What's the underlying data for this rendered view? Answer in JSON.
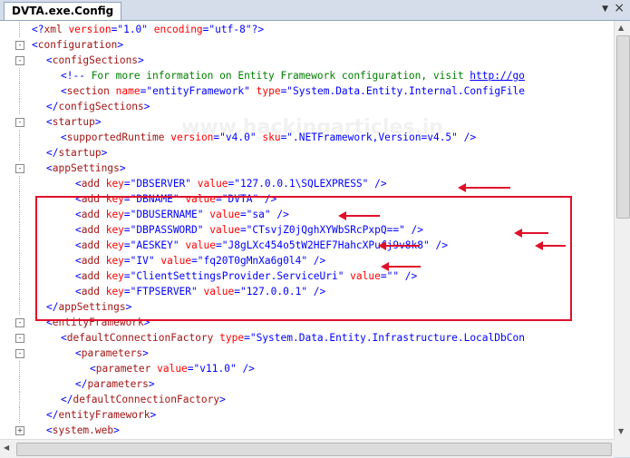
{
  "tab": {
    "title": "DVTA.exe.Config"
  },
  "watermark": "www.hackingarticles.in",
  "lines": [
    {
      "parts": [
        [
          "b",
          "<?"
        ],
        [
          "t",
          "xml"
        ],
        [
          "a",
          " version"
        ],
        [
          "b",
          "=\""
        ],
        [
          "v",
          "1.0"
        ],
        [
          "b",
          "\""
        ],
        [
          "a",
          " encoding"
        ],
        [
          "b",
          "=\""
        ],
        [
          "v",
          "utf-8"
        ],
        [
          "b",
          "\"?>"
        ]
      ]
    },
    {
      "parts": [
        [
          "b",
          "<"
        ],
        [
          "t",
          "configuration"
        ],
        [
          "b",
          ">"
        ]
      ]
    },
    {
      "parts": [
        [
          "b",
          "<"
        ],
        [
          "t",
          "configSections"
        ],
        [
          "b",
          ">"
        ]
      ]
    },
    {
      "parts": [
        [
          "b",
          "<!--"
        ],
        [
          "c",
          " For more information on Entity Framework configuration, visit "
        ],
        [
          "u",
          "http://go"
        ]
      ]
    },
    {
      "parts": [
        [
          "b",
          "<"
        ],
        [
          "t",
          "section"
        ],
        [
          "a",
          " name"
        ],
        [
          "b",
          "=\""
        ],
        [
          "v",
          "entityFramework"
        ],
        [
          "b",
          "\""
        ],
        [
          "a",
          " type"
        ],
        [
          "b",
          "=\""
        ],
        [
          "v",
          "System.Data.Entity.Internal.ConfigFile"
        ]
      ]
    },
    {
      "parts": [
        [
          "b",
          "</"
        ],
        [
          "t",
          "configSections"
        ],
        [
          "b",
          ">"
        ]
      ]
    },
    {
      "parts": [
        [
          "b",
          "<"
        ],
        [
          "t",
          "startup"
        ],
        [
          "b",
          ">"
        ]
      ]
    },
    {
      "parts": [
        [
          "b",
          "<"
        ],
        [
          "t",
          "supportedRuntime"
        ],
        [
          "a",
          " version"
        ],
        [
          "b",
          "=\""
        ],
        [
          "v",
          "v4.0"
        ],
        [
          "b",
          "\""
        ],
        [
          "a",
          " sku"
        ],
        [
          "b",
          "=\""
        ],
        [
          "v",
          ".NETFramework,Version=v4.5"
        ],
        [
          "b",
          "\" />"
        ]
      ]
    },
    {
      "parts": [
        [
          "b",
          "</"
        ],
        [
          "t",
          "startup"
        ],
        [
          "b",
          ">"
        ]
      ]
    },
    {
      "parts": [
        [
          "b",
          "<"
        ],
        [
          "t",
          "appSettings"
        ],
        [
          "b",
          ">"
        ]
      ]
    },
    {
      "parts": [
        [
          "b",
          "<"
        ],
        [
          "t",
          "add"
        ],
        [
          "a",
          " key"
        ],
        [
          "b",
          "=\""
        ],
        [
          "v",
          "DBSERVER"
        ],
        [
          "b",
          "\""
        ],
        [
          "a",
          " value"
        ],
        [
          "b",
          "=\""
        ],
        [
          "v",
          "127.0.0.1\\SQLEXPRESS"
        ],
        [
          "b",
          "\" />"
        ]
      ]
    },
    {
      "parts": [
        [
          "b",
          "<"
        ],
        [
          "t",
          "add"
        ],
        [
          "a",
          " key"
        ],
        [
          "b",
          "=\""
        ],
        [
          "v",
          "DBNAME"
        ],
        [
          "b",
          "\""
        ],
        [
          "a",
          " value"
        ],
        [
          "b",
          "=\""
        ],
        [
          "v",
          "DVTA"
        ],
        [
          "b",
          "\" />"
        ]
      ]
    },
    {
      "parts": [
        [
          "b",
          "<"
        ],
        [
          "t",
          "add"
        ],
        [
          "a",
          " key"
        ],
        [
          "b",
          "=\""
        ],
        [
          "v",
          "DBUSERNAME"
        ],
        [
          "b",
          "\""
        ],
        [
          "a",
          " value"
        ],
        [
          "b",
          "=\""
        ],
        [
          "v",
          "sa"
        ],
        [
          "b",
          "\" />"
        ]
      ]
    },
    {
      "parts": [
        [
          "b",
          "<"
        ],
        [
          "t",
          "add"
        ],
        [
          "a",
          " key"
        ],
        [
          "b",
          "=\""
        ],
        [
          "v",
          "DBPASSWORD"
        ],
        [
          "b",
          "\""
        ],
        [
          "a",
          " value"
        ],
        [
          "b",
          "=\""
        ],
        [
          "v",
          "CTsvjZ0jQghXYWbSRcPxpQ=="
        ],
        [
          "b",
          "\" />"
        ]
      ]
    },
    {
      "parts": [
        [
          "b",
          "<"
        ],
        [
          "t",
          "add"
        ],
        [
          "a",
          " key"
        ],
        [
          "b",
          "=\""
        ],
        [
          "v",
          "AESKEY"
        ],
        [
          "b",
          "\""
        ],
        [
          "a",
          " value"
        ],
        [
          "b",
          "=\""
        ],
        [
          "v",
          "J8gLXc454o5tW2HEF7HahcXPufj9v8k8"
        ],
        [
          "b",
          "\" />"
        ]
      ]
    },
    {
      "parts": [
        [
          "b",
          "<"
        ],
        [
          "t",
          "add"
        ],
        [
          "a",
          " key"
        ],
        [
          "b",
          "=\""
        ],
        [
          "v",
          "IV"
        ],
        [
          "b",
          "\""
        ],
        [
          "a",
          " value"
        ],
        [
          "b",
          "=\""
        ],
        [
          "v",
          "fq20T0gMnXa6g0l4"
        ],
        [
          "b",
          "\" />"
        ]
      ]
    },
    {
      "parts": [
        [
          "b",
          "<"
        ],
        [
          "t",
          "add"
        ],
        [
          "a",
          " key"
        ],
        [
          "b",
          "=\""
        ],
        [
          "v",
          "ClientSettingsProvider.ServiceUri"
        ],
        [
          "b",
          "\""
        ],
        [
          "a",
          " value"
        ],
        [
          "b",
          "=\"\" />"
        ]
      ]
    },
    {
      "parts": [
        [
          "b",
          "<"
        ],
        [
          "t",
          "add"
        ],
        [
          "a",
          " key"
        ],
        [
          "b",
          "=\""
        ],
        [
          "v",
          "FTPSERVER"
        ],
        [
          "b",
          "\""
        ],
        [
          "a",
          " value"
        ],
        [
          "b",
          "=\""
        ],
        [
          "v",
          "127.0.0.1"
        ],
        [
          "b",
          "\" />"
        ]
      ]
    },
    {
      "parts": [
        [
          "b",
          "</"
        ],
        [
          "t",
          "appSettings"
        ],
        [
          "b",
          ">"
        ]
      ]
    },
    {
      "parts": [
        [
          "b",
          "<"
        ],
        [
          "t",
          "entityFramework"
        ],
        [
          "b",
          ">"
        ]
      ]
    },
    {
      "parts": [
        [
          "b",
          "<"
        ],
        [
          "t",
          "defaultConnectionFactory"
        ],
        [
          "a",
          " type"
        ],
        [
          "b",
          "=\""
        ],
        [
          "v",
          "System.Data.Entity.Infrastructure.LocalDbCon"
        ]
      ]
    },
    {
      "parts": [
        [
          "b",
          "<"
        ],
        [
          "t",
          "parameters"
        ],
        [
          "b",
          ">"
        ]
      ]
    },
    {
      "parts": [
        [
          "b",
          "<"
        ],
        [
          "t",
          "parameter"
        ],
        [
          "a",
          " value"
        ],
        [
          "b",
          "=\""
        ],
        [
          "v",
          "v11.0"
        ],
        [
          "b",
          "\" />"
        ]
      ]
    },
    {
      "parts": [
        [
          "b",
          "</"
        ],
        [
          "t",
          "parameters"
        ],
        [
          "b",
          ">"
        ]
      ]
    },
    {
      "parts": [
        [
          "b",
          "</"
        ],
        [
          "t",
          "defaultConnectionFactory"
        ],
        [
          "b",
          ">"
        ]
      ]
    },
    {
      "parts": [
        [
          "b",
          "</"
        ],
        [
          "t",
          "entityFramework"
        ],
        [
          "b",
          ">"
        ]
      ]
    },
    {
      "parts": [
        [
          "b",
          "<"
        ],
        [
          "t",
          "system.web"
        ],
        [
          "b",
          ">"
        ]
      ]
    }
  ]
}
